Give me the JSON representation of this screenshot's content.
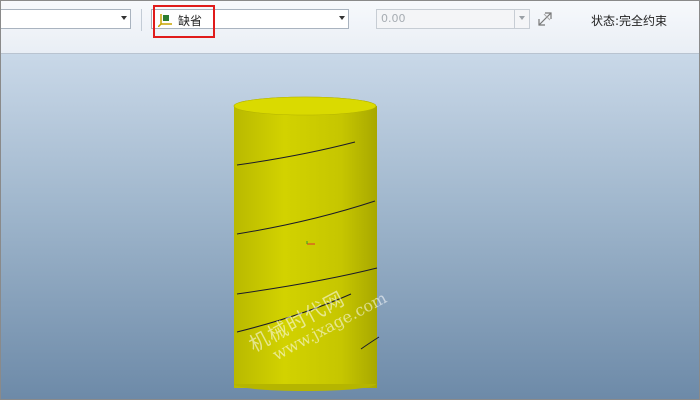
{
  "toolbar": {
    "left_combo_value": "",
    "reference_combo": {
      "value": "缺省",
      "icon": "coordinate-reference-icon"
    },
    "value_field": {
      "value": "0.00",
      "enabled": false
    },
    "flip_icon": "flip-direction-icon",
    "status_text": "状态:完全约束",
    "highlight_color": "#e01b1b"
  },
  "viewport": {
    "background_top": "#c9d8e8",
    "background_bottom": "#6d8aa8",
    "model": {
      "type": "cylinder",
      "color": "#c8c800",
      "helix_turns_visible": 5
    },
    "watermark": {
      "line1": "机械时代网",
      "line2": "www.jxage.com"
    }
  }
}
